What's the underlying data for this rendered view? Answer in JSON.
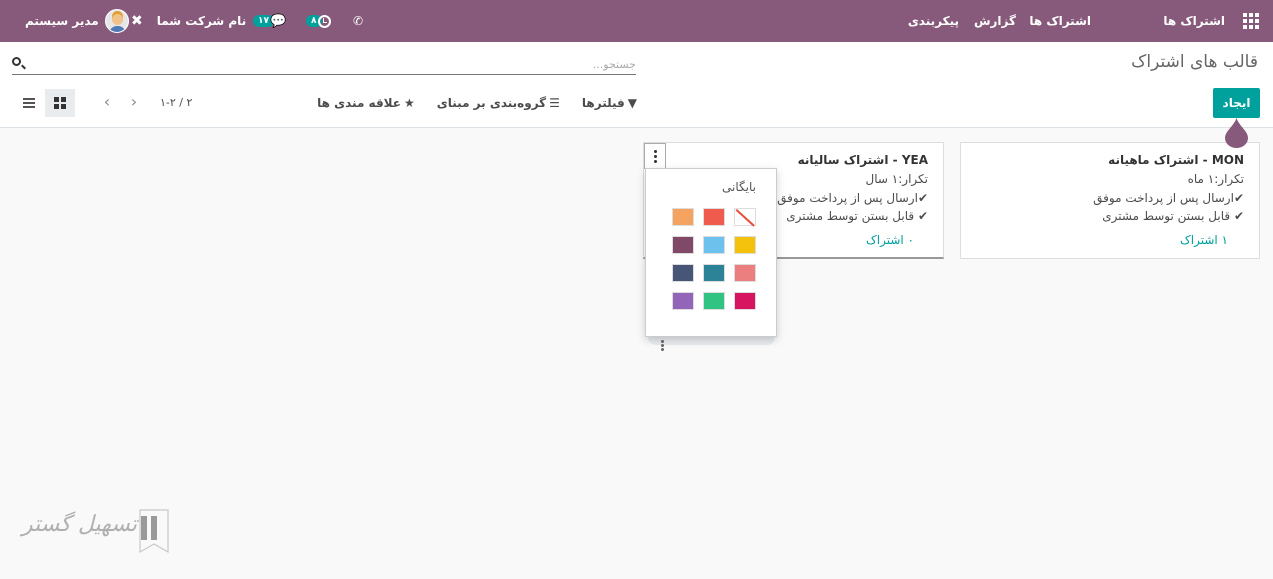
{
  "navbar": {
    "brand": "اشتراک ها",
    "menus": [
      "اشتراک ها",
      "گزارش",
      "پیکربندی"
    ],
    "activity_count": "۸",
    "message_count": "۱۷",
    "company": "نام شرکت شما",
    "user": "مدیر سیستم",
    "color": "#875a7b"
  },
  "control": {
    "title": "قالب های اشتراک",
    "search_placeholder": "جستجو...",
    "create_label": "ایجاد",
    "filters_label": "فیلترها",
    "groupby_label": "گروه‌بندی بر مبنای",
    "favorites_label": "علاقه مندی ها",
    "pager": "۱-۲ / ۲",
    "accent": "#00a09d"
  },
  "cards": [
    {
      "title": "MON - اشتراک ماهیانه",
      "recurrence": "تکرار:۱ ماه",
      "check1": "ارسال پس از پرداخت موفق",
      "check2": "قابل بستن توسط مشتری",
      "link": "۱ اشتراک"
    },
    {
      "title": "YEA - اشتراک سالیانه",
      "recurrence": "تکرار:۱ سال",
      "check1": "ارسال پس از پرداخت موفق",
      "check2": "قابل بستن توسط مشتری",
      "link": "۰ اشتراک"
    }
  ],
  "dropdown": {
    "archive_label": "بایگانی",
    "colors": [
      "none",
      "#ef5b4c",
      "#f4a460",
      "#f4c20d",
      "#6cc1ed",
      "#814968",
      "#eb7e7f",
      "#2c8397",
      "#475577",
      "#d6145f",
      "#30c381",
      "#9365b8"
    ]
  },
  "watermark": {
    "text": "تسهیل گستر"
  }
}
